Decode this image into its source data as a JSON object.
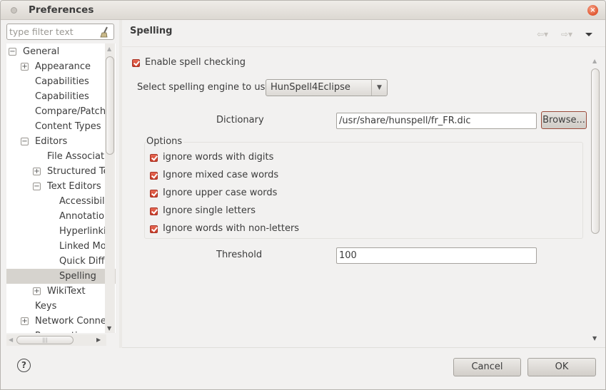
{
  "window": {
    "title": "Preferences"
  },
  "filter": {
    "placeholder": "type filter text"
  },
  "tree": [
    {
      "label": "General",
      "expander": "−"
    },
    {
      "label": "Appearance",
      "expander": "+"
    },
    {
      "label": "Capabilities",
      "expander": ""
    },
    {
      "label": "Capabilities",
      "expander": ""
    },
    {
      "label": "Compare/Patch",
      "expander": ""
    },
    {
      "label": "Content Types",
      "expander": ""
    },
    {
      "label": "Editors",
      "expander": "−"
    },
    {
      "label": "File Associati",
      "expander": ""
    },
    {
      "label": "Structured Te",
      "expander": "+"
    },
    {
      "label": "Text Editors",
      "expander": "−"
    },
    {
      "label": "Accessibili",
      "expander": ""
    },
    {
      "label": "Annotation",
      "expander": ""
    },
    {
      "label": "Hyperlinki",
      "expander": ""
    },
    {
      "label": "Linked Mo",
      "expander": ""
    },
    {
      "label": "Quick Diff",
      "expander": ""
    },
    {
      "label": "Spelling",
      "expander": ""
    },
    {
      "label": "WikiText",
      "expander": "+"
    },
    {
      "label": "Keys",
      "expander": ""
    },
    {
      "label": "Network Connec",
      "expander": "+"
    },
    {
      "label": "Perspectives",
      "expander": ""
    }
  ],
  "selected_tree_item": "Spelling",
  "page": {
    "title": "Spelling",
    "enable_spell": "Enable spell checking",
    "engine_label": "Select spelling engine to use:",
    "engine_value": "HunSpell4Eclipse",
    "dictionary_label": "Dictionary",
    "dictionary_value": "/usr/share/hunspell/fr_FR.dic",
    "browse_label": "Browse...",
    "options_label": "Options",
    "options": [
      "ignore words with digits",
      "Ignore mixed case words",
      "Ignore upper case words",
      "Ignore single letters",
      "Ignore words with non-letters"
    ],
    "threshold_label": "Threshold",
    "threshold_value": "100"
  },
  "footer": {
    "cancel": "Cancel",
    "ok": "OK",
    "help": "?"
  },
  "colors": {
    "accent": "#d6452f",
    "selection": "#d6d3ce",
    "background": "#f2f1f0"
  },
  "icons": {
    "close": "×",
    "back": "⇦▾",
    "forward": "⇨▾"
  }
}
